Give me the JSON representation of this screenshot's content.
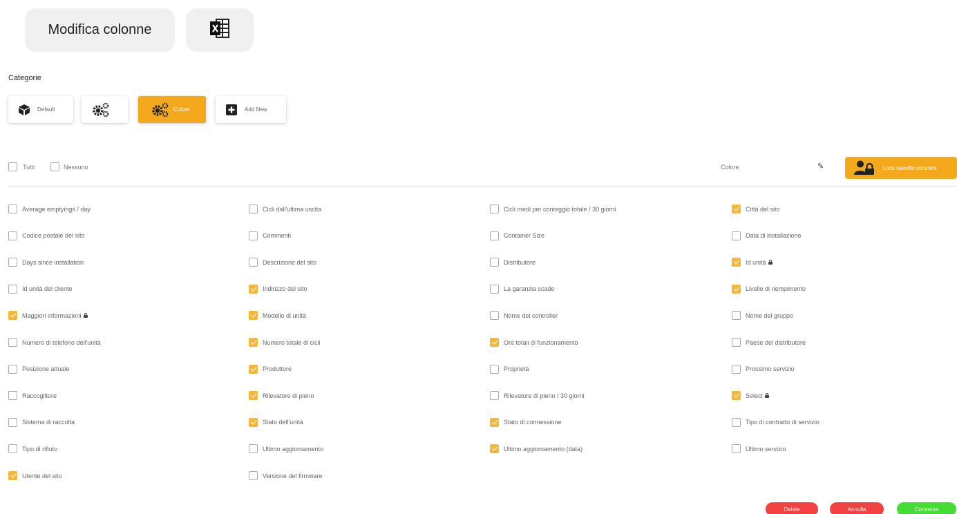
{
  "header": {
    "edit_columns_label": "Modifica colonne",
    "export_icon": "excel-icon"
  },
  "categories": {
    "label": "Categorie",
    "items": [
      {
        "label": "Default",
        "icon": "cube-icon",
        "active": false
      },
      {
        "label": "",
        "icon": "gears-icon",
        "active": false
      },
      {
        "label": "Colore",
        "icon": "gears-icon",
        "active": true
      },
      {
        "label": "Add New",
        "icon": "plus-square-icon",
        "active": false
      }
    ]
  },
  "selection": {
    "all_label": "Tutti",
    "none_label": "Nessuno"
  },
  "toolbar": {
    "color_label": "Colore",
    "pencil_icon": "pencil-icon",
    "lock_button_label": "Lock specific columns"
  },
  "columns": [
    [
      {
        "label": "Average emptyings / day",
        "checked": false,
        "locked": false
      },
      {
        "label": "Codice postale del sito",
        "checked": false,
        "locked": false
      },
      {
        "label": "Days since installation",
        "checked": false,
        "locked": false
      },
      {
        "label": "Id unità del cliente",
        "checked": false,
        "locked": false
      },
      {
        "label": "Maggiori informazioni",
        "checked": true,
        "locked": true
      },
      {
        "label": "Numero di telefono dell'unità",
        "checked": false,
        "locked": false
      },
      {
        "label": "Posizione attuale",
        "checked": false,
        "locked": false
      },
      {
        "label": "Raccoglitore",
        "checked": false,
        "locked": false
      },
      {
        "label": "Sistema di raccolta",
        "checked": false,
        "locked": false
      },
      {
        "label": "Tipo di rifiuto",
        "checked": false,
        "locked": false
      },
      {
        "label": "Utente del sito",
        "checked": true,
        "locked": false
      }
    ],
    [
      {
        "label": "Cicli dall'ultima uscita",
        "checked": false,
        "locked": false
      },
      {
        "label": "Commenti",
        "checked": false,
        "locked": false
      },
      {
        "label": "Descrizione del sito",
        "checked": false,
        "locked": false
      },
      {
        "label": "Indirizzo del sito",
        "checked": true,
        "locked": false
      },
      {
        "label": "Modello di unità",
        "checked": true,
        "locked": false
      },
      {
        "label": "Numero totale di cicli",
        "checked": true,
        "locked": false
      },
      {
        "label": "Produttore",
        "checked": true,
        "locked": false
      },
      {
        "label": "Rilevatore di pieno",
        "checked": true,
        "locked": false
      },
      {
        "label": "Stato dell'unità",
        "checked": true,
        "locked": false
      },
      {
        "label": "Ultimo aggiornamento",
        "checked": false,
        "locked": false
      },
      {
        "label": "Versione del firmware",
        "checked": false,
        "locked": false
      }
    ],
    [
      {
        "label": "Cicli medi per conteggio totale / 30 giorni",
        "checked": false,
        "locked": false
      },
      {
        "label": "Container Size",
        "checked": false,
        "locked": false
      },
      {
        "label": "Distributore",
        "checked": false,
        "locked": false
      },
      {
        "label": "La garanzia scade",
        "checked": false,
        "locked": false
      },
      {
        "label": "Nome del controller",
        "checked": false,
        "locked": false
      },
      {
        "label": "Ore totali di funzionamento",
        "checked": true,
        "locked": false
      },
      {
        "label": "Proprietà",
        "checked": false,
        "locked": false
      },
      {
        "label": "Rilevatore di pieno / 30 giorni",
        "checked": false,
        "locked": false
      },
      {
        "label": "Stato di connessione",
        "checked": true,
        "locked": false
      },
      {
        "label": "Ultimo aggiornamento (data)",
        "checked": true,
        "locked": false
      }
    ],
    [
      {
        "label": "Città del sito",
        "checked": true,
        "locked": false
      },
      {
        "label": "Data di installazione",
        "checked": false,
        "locked": false
      },
      {
        "label": "Id unità",
        "checked": true,
        "locked": true
      },
      {
        "label": "Livello di riempimento",
        "checked": true,
        "locked": false
      },
      {
        "label": "Nome del gruppo",
        "checked": false,
        "locked": false
      },
      {
        "label": "Paese del distributore",
        "checked": false,
        "locked": false
      },
      {
        "label": "Prossimo servizio",
        "checked": false,
        "locked": false
      },
      {
        "label": "Select",
        "checked": true,
        "locked": true
      },
      {
        "label": "Tipo di contratto di servizio",
        "checked": false,
        "locked": false
      },
      {
        "label": "Ultimo servizio",
        "checked": false,
        "locked": false
      }
    ]
  ],
  "footer": {
    "delete_label": "Delete",
    "cancel_label": "Annulla",
    "save_label": "Conserva"
  },
  "colors": {
    "accent": "#f4a81c",
    "check": "#f4b73a",
    "danger": "#f24141",
    "success": "#45dc35"
  }
}
